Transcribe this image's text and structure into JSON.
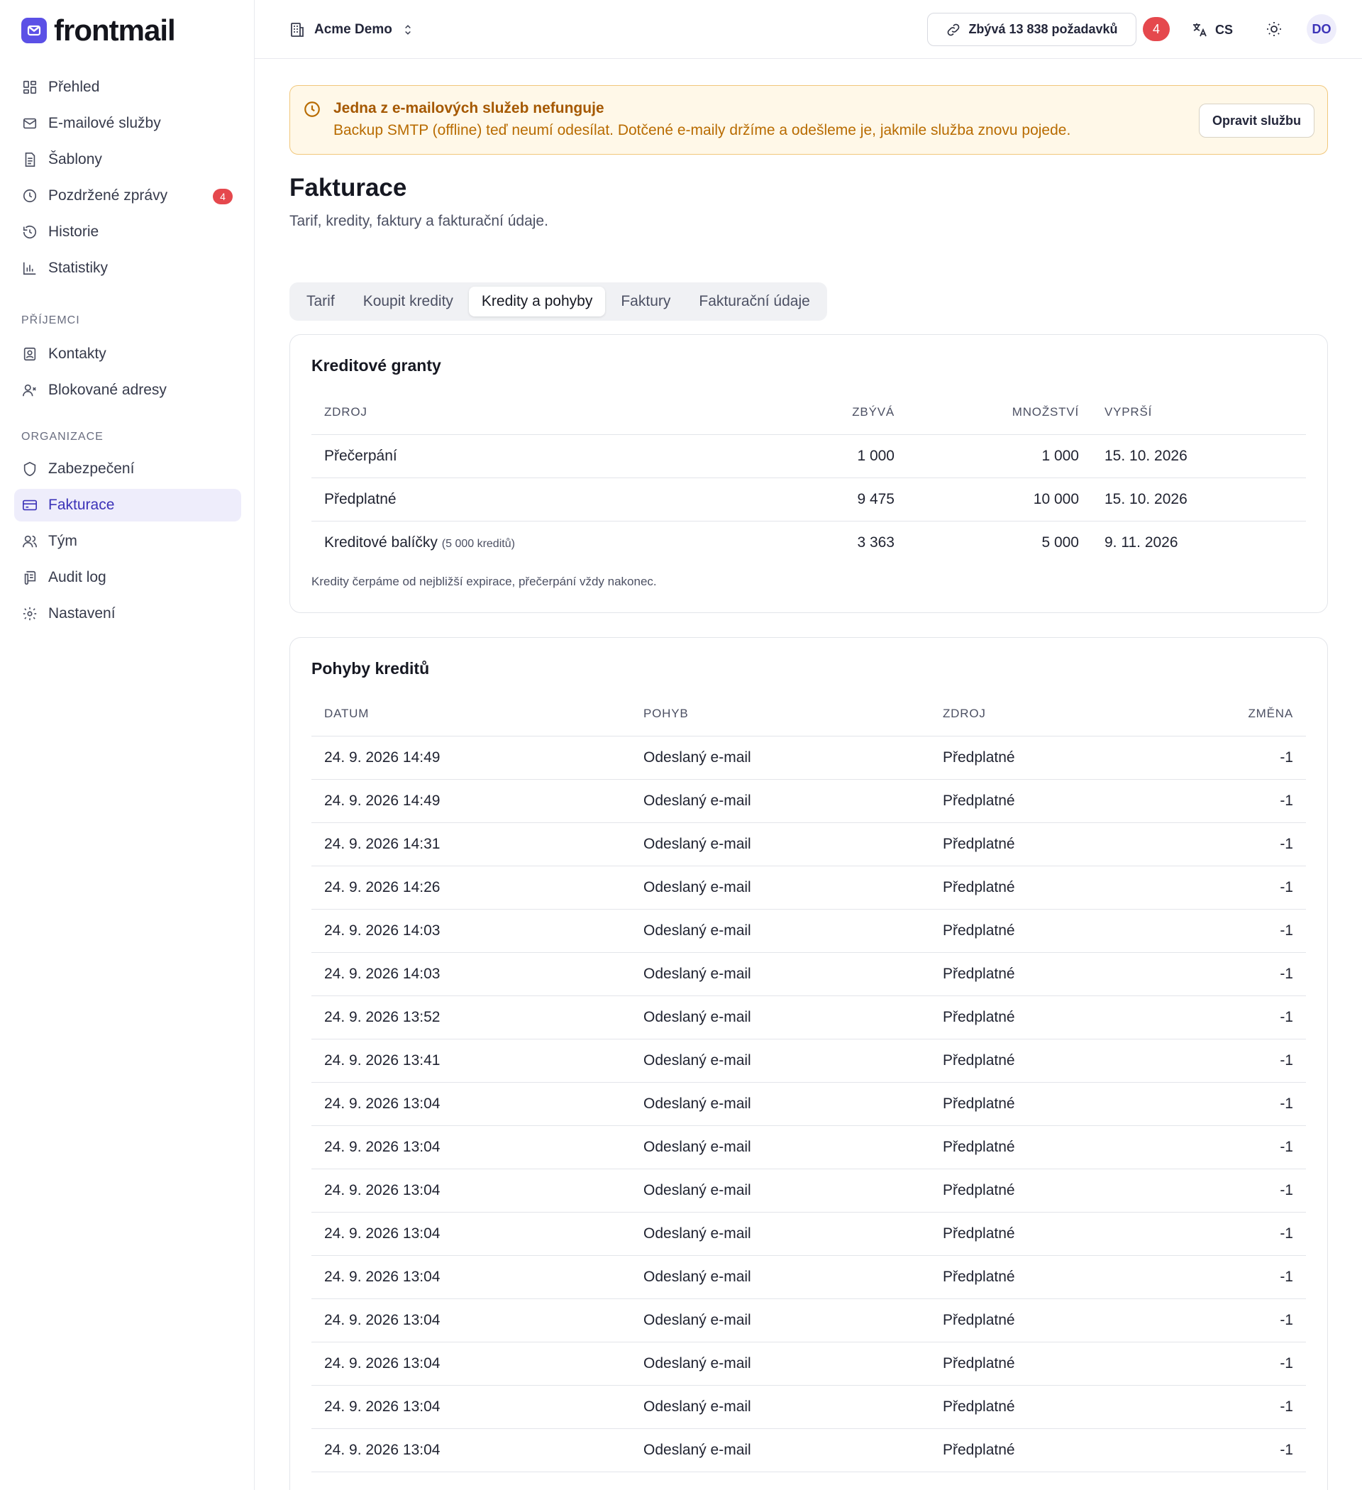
{
  "brand": {
    "name": "frontmail",
    "color": "#5b50e6"
  },
  "sidebar": {
    "main_items": [
      {
        "label": "Přehled",
        "icon": "grid-icon"
      },
      {
        "label": "E-mailové služby",
        "icon": "mail-icon"
      },
      {
        "label": "Šablony",
        "icon": "document-icon"
      },
      {
        "label": "Pozdržené zprávy",
        "icon": "clock-icon",
        "badge": "4"
      },
      {
        "label": "Historie",
        "icon": "history-icon"
      },
      {
        "label": "Statistiky",
        "icon": "bar-chart-icon"
      }
    ],
    "section_recipients": "PŘÍJEMCI",
    "recipient_items": [
      {
        "label": "Kontakty",
        "icon": "contact-icon"
      },
      {
        "label": "Blokované adresy",
        "icon": "user-block-icon"
      }
    ],
    "section_org": "ORGANIZACE",
    "org_items": [
      {
        "label": "Zabezpečení",
        "icon": "shield-icon"
      },
      {
        "label": "Fakturace",
        "icon": "credit-card-icon",
        "active": true
      },
      {
        "label": "Tým",
        "icon": "team-icon"
      },
      {
        "label": "Audit log",
        "icon": "audit-icon"
      },
      {
        "label": "Nastavení",
        "icon": "gear-icon"
      }
    ]
  },
  "header": {
    "org_name": "Acme Demo",
    "quota_label": "Zbývá 13 838 požadavků",
    "badge": "4",
    "language": "CS",
    "avatar": "DO"
  },
  "alert": {
    "title": "Jedna z e-mailových služeb nefunguje",
    "text": "Backup SMTP (offline) teď neumí odesílat. Dotčené e-maily držíme a odešleme je, jakmile služba znovu pojede.",
    "button": "Opravit službu"
  },
  "page": {
    "title": "Fakturace",
    "subtitle": "Tarif, kredity, faktury a fakturační údaje."
  },
  "tabs": [
    {
      "label": "Tarif"
    },
    {
      "label": "Koupit kredity"
    },
    {
      "label": "Kredity a pohyby",
      "active": true
    },
    {
      "label": "Faktury"
    },
    {
      "label": "Fakturační údaje"
    }
  ],
  "grants": {
    "title": "Kreditové granty",
    "headers": [
      "ZDROJ",
      "ZBÝVÁ",
      "MNOŽSTVÍ",
      "VYPRŠÍ"
    ],
    "rows": [
      {
        "source": "Přečerpání",
        "note": "",
        "remaining": "1 000",
        "amount": "1 000",
        "expires": "15. 10. 2026"
      },
      {
        "source": "Předplatné",
        "note": "",
        "remaining": "9 475",
        "amount": "10 000",
        "expires": "15. 10. 2026"
      },
      {
        "source": "Kreditové balíčky",
        "note": "(5 000 kreditů)",
        "remaining": "3 363",
        "amount": "5 000",
        "expires": "9. 11. 2026"
      }
    ],
    "footnote": "Kredity čerpáme od nejbližší expirace, přečerpání vždy nakonec."
  },
  "movements": {
    "title": "Pohyby kreditů",
    "headers": [
      "DATUM",
      "POHYB",
      "ZDROJ",
      "ZMĚNA"
    ],
    "rows": [
      {
        "date": "24. 9. 2026 14:49",
        "type": "Odeslaný e-mail",
        "source": "Předplatné",
        "change": "-1"
      },
      {
        "date": "24. 9. 2026 14:49",
        "type": "Odeslaný e-mail",
        "source": "Předplatné",
        "change": "-1"
      },
      {
        "date": "24. 9. 2026 14:31",
        "type": "Odeslaný e-mail",
        "source": "Předplatné",
        "change": "-1"
      },
      {
        "date": "24. 9. 2026 14:26",
        "type": "Odeslaný e-mail",
        "source": "Předplatné",
        "change": "-1"
      },
      {
        "date": "24. 9. 2026 14:03",
        "type": "Odeslaný e-mail",
        "source": "Předplatné",
        "change": "-1"
      },
      {
        "date": "24. 9. 2026 14:03",
        "type": "Odeslaný e-mail",
        "source": "Předplatné",
        "change": "-1"
      },
      {
        "date": "24. 9. 2026 13:52",
        "type": "Odeslaný e-mail",
        "source": "Předplatné",
        "change": "-1"
      },
      {
        "date": "24. 9. 2026 13:41",
        "type": "Odeslaný e-mail",
        "source": "Předplatné",
        "change": "-1"
      },
      {
        "date": "24. 9. 2026 13:04",
        "type": "Odeslaný e-mail",
        "source": "Předplatné",
        "change": "-1"
      },
      {
        "date": "24. 9. 2026 13:04",
        "type": "Odeslaný e-mail",
        "source": "Předplatné",
        "change": "-1"
      },
      {
        "date": "24. 9. 2026 13:04",
        "type": "Odeslaný e-mail",
        "source": "Předplatné",
        "change": "-1"
      },
      {
        "date": "24. 9. 2026 13:04",
        "type": "Odeslaný e-mail",
        "source": "Předplatné",
        "change": "-1"
      },
      {
        "date": "24. 9. 2026 13:04",
        "type": "Odeslaný e-mail",
        "source": "Předplatné",
        "change": "-1"
      },
      {
        "date": "24. 9. 2026 13:04",
        "type": "Odeslaný e-mail",
        "source": "Předplatné",
        "change": "-1"
      },
      {
        "date": "24. 9. 2026 13:04",
        "type": "Odeslaný e-mail",
        "source": "Předplatné",
        "change": "-1"
      },
      {
        "date": "24. 9. 2026 13:04",
        "type": "Odeslaný e-mail",
        "source": "Předplatné",
        "change": "-1"
      },
      {
        "date": "24. 9. 2026 13:04",
        "type": "Odeslaný e-mail",
        "source": "Předplatné",
        "change": "-1"
      }
    ]
  }
}
